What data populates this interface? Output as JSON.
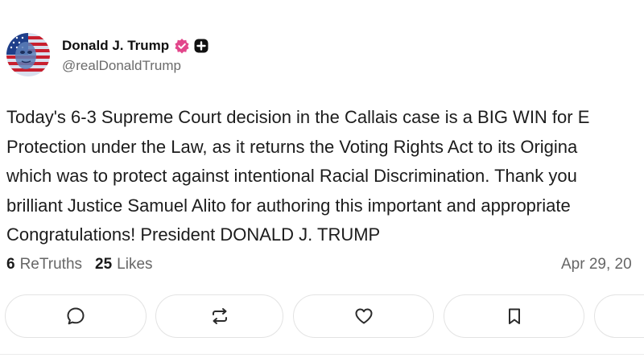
{
  "author": {
    "display_name": "Donald J. Trump",
    "handle": "@realDonaldTrump",
    "verified_color": "#e2468b"
  },
  "post": {
    "lines": [
      "Today's 6-3 Supreme Court decision in the Callais case is a BIG WIN for E",
      "Protection under the Law, as it returns the Voting Rights Act to its Origina",
      "which was to protect against intentional Racial Discrimination. Thank you",
      "brilliant Justice Samuel Alito for authoring this important and appropriate",
      "Congratulations! President DONALD J. TRUMP"
    ]
  },
  "stats": {
    "retruths_count": "6",
    "retruths_label": "ReTruths",
    "likes_count": "25",
    "likes_label": "Likes",
    "timestamp": "Apr 29, 20"
  },
  "actions": [
    {
      "icon": "comment-icon"
    },
    {
      "icon": "retruth-icon"
    },
    {
      "icon": "heart-icon"
    },
    {
      "icon": "bookmark-icon"
    },
    {
      "icon": "more-icon"
    }
  ]
}
